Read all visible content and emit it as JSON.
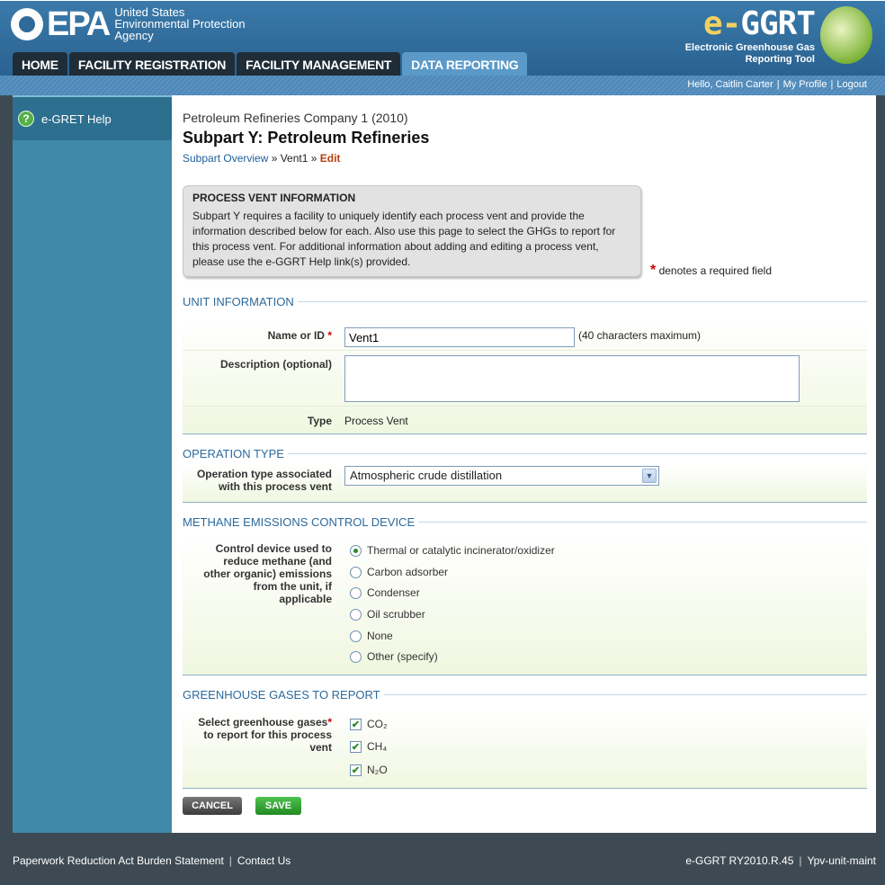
{
  "header": {
    "agency_mark": "EPA",
    "agency_name_line1": "United States",
    "agency_name_line2": "Environmental Protection",
    "agency_name_line3": "Agency",
    "app_title_prefix": "e-",
    "app_title_main": "GGRT",
    "app_sub_line1": "Electronic Greenhouse Gas",
    "app_sub_line2": "Reporting Tool"
  },
  "tabs": [
    {
      "label": "HOME"
    },
    {
      "label": "FACILITY REGISTRATION"
    },
    {
      "label": "FACILITY MANAGEMENT"
    },
    {
      "label": "DATA REPORTING",
      "active": true
    }
  ],
  "userbar": {
    "greeting": "Hello, Caitlin Carter",
    "profile": "My Profile",
    "logout": "Logout"
  },
  "sidebar": {
    "help_label": "e-GRET Help"
  },
  "main": {
    "company": "Petroleum Refineries Company 1 (2010)",
    "subpart": "Subpart Y: Petroleum Refineries",
    "breadcrumb_link": "Subpart Overview",
    "breadcrumb_sep1": " » ",
    "breadcrumb_item": "Vent1",
    "breadcrumb_sep2": " » ",
    "breadcrumb_current": "Edit",
    "info_title": "PROCESS VENT INFORMATION",
    "info_text": "Subpart Y requires a facility to uniquely identify each process vent and provide the information described below for each. Also use this page to select the GHGs to report for this process vent. For additional information about adding and editing a process vent, please use the e-GGRT Help link(s) provided.",
    "required_star": "*",
    "required_note": " denotes a required field"
  },
  "unit_info": {
    "title": "UNIT INFORMATION",
    "name_label": "Name or ID",
    "name_value": "Vent1",
    "name_hint": "(40 characters maximum)",
    "desc_label": "Description (optional)",
    "desc_value": "",
    "type_label": "Type",
    "type_value": "Process Vent"
  },
  "operation": {
    "title": "OPERATION TYPE",
    "label_line1": "Operation type associated",
    "label_line2": "with this process vent",
    "selected": "Atmospheric crude distillation"
  },
  "methane": {
    "title": "METHANE EMISSIONS CONTROL DEVICE",
    "label_lines": [
      "Control device used to",
      "reduce methane (and",
      "other organic) emissions",
      "from the unit, if",
      "applicable"
    ],
    "options": [
      {
        "label": "Thermal or catalytic incinerator/oxidizer",
        "selected": true
      },
      {
        "label": "Carbon adsorber",
        "selected": false
      },
      {
        "label": "Condenser",
        "selected": false
      },
      {
        "label": "Oil scrubber",
        "selected": false
      },
      {
        "label": "None",
        "selected": false
      },
      {
        "label": "Other (specify)",
        "selected": false
      }
    ]
  },
  "ghg": {
    "title": "GREENHOUSE GASES TO REPORT",
    "label_lines": [
      "Select greenhouse gases",
      "to report for this process",
      "vent"
    ],
    "gases": [
      {
        "label": "CO₂",
        "checked": true
      },
      {
        "label": "CH₄",
        "checked": true
      },
      {
        "label": "N₂O",
        "checked": true
      }
    ]
  },
  "buttons": {
    "cancel": "CANCEL",
    "save": "SAVE"
  },
  "footer": {
    "paperwork": "Paperwork Reduction Act Burden Statement",
    "contact": "Contact Us",
    "version": "e-GGRT RY2010.R.45",
    "page_id": "Ypv-unit-maint"
  },
  "colors": {
    "header_blue": "#2f6b9a",
    "active_tab": "#5b9ac8",
    "sidebar": "#4189a8",
    "required_red": "#cc0000",
    "save_green": "#238a23"
  }
}
